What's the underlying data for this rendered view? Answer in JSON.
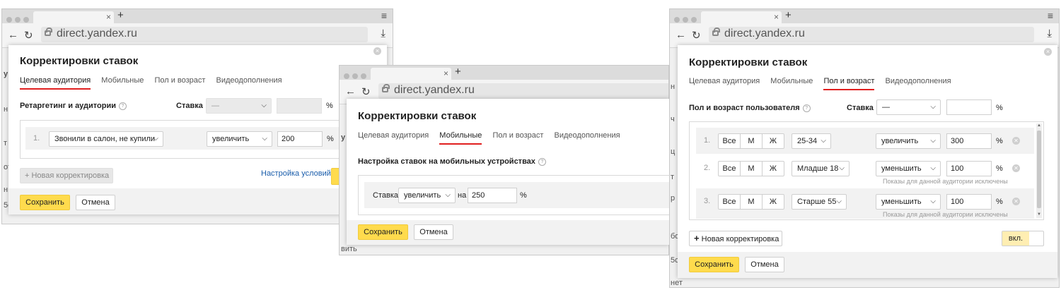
{
  "browser": {
    "url": "direct.yandex.ru",
    "tab_close": "×",
    "new_tab": "+",
    "menu_glyph": "≡",
    "back_glyph": "←",
    "reload_glyph": "↻",
    "download_glyph": "⤓"
  },
  "modal": {
    "title": "Корректировки ставок",
    "close_glyph": "×",
    "tabs": [
      "Целевая аудитория",
      "Мобильные",
      "Пол и возраст",
      "Видеодополнения"
    ],
    "save_label": "Сохранить",
    "cancel_label": "Отмена",
    "percent": "%",
    "help": "?"
  },
  "left": {
    "section": "Ретаргетинг и аудитории",
    "bid_label": "Ставка",
    "bid_select": "—",
    "row_num": "1.",
    "audience": "Звонили в салон, не купили",
    "action": "увеличить",
    "value": "200",
    "add_button": "+ Новая корректировка",
    "conditions_link": "Настройка условий",
    "bg_text": [
      "у",
      "н",
      "т",
      "от",
      "н",
      "5с"
    ]
  },
  "middle": {
    "section": "Настройка ставок на мобильных устройствах",
    "bid_label": "Ставка",
    "action": "увеличить",
    "on_label": "на",
    "value": "250",
    "bg_text": [
      "у",
      "вить"
    ]
  },
  "right": {
    "section": "Пол и возраст пользователя",
    "bid_label": "Ставка",
    "bid_select": "—",
    "gender_options": [
      "Все",
      "М",
      "Ж"
    ],
    "rows": [
      {
        "num": "1.",
        "age": "25-34",
        "action": "увеличить",
        "value": "300",
        "note": ""
      },
      {
        "num": "2.",
        "age": "Младше 18",
        "action": "уменьшить",
        "value": "100",
        "note": "Показы для данной аудитории исключены"
      },
      {
        "num": "3.",
        "age": "Старше 55",
        "action": "уменьшить",
        "value": "100",
        "note": "Показы для данной аудитории исключены"
      }
    ],
    "add_button": "Новая корректировка",
    "add_plus": "+",
    "toggle_label": "вкл.",
    "bg_text": [
      "н",
      "ч",
      "ц",
      "т",
      "р",
      "бо",
      "5с",
      "нет"
    ]
  }
}
